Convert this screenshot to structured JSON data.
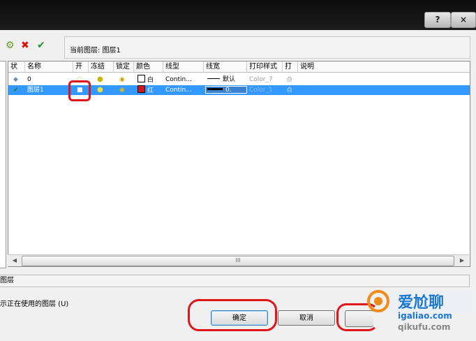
{
  "window": {
    "help_label": "?",
    "close_label": "×"
  },
  "toolbar": {
    "new_icon": "new-layer-icon",
    "delete_icon": "delete-layer-icon",
    "set_current_icon": "set-current-icon",
    "current_layer_label": "当前图层: 图层1"
  },
  "grid": {
    "columns": [
      "状",
      "名称",
      "开",
      "冻结",
      "锁定",
      "颜色",
      "线型",
      "线宽",
      "打印样式",
      "打",
      "说明"
    ],
    "rows": [
      {
        "status_icon": "layer-state-icon",
        "name": "0",
        "color_name": "白",
        "color_hex": "#ffffff",
        "linetype": "Contin...",
        "lineweight": "默认",
        "plot_style": "Color_7",
        "selected": false
      },
      {
        "status_icon": "current-check-icon",
        "name": "图层1",
        "color_name": "红",
        "color_hex": "#d4161e",
        "linetype": "Contin...",
        "lineweight": "0.",
        "plot_style": "Color_1",
        "selected": true
      }
    ],
    "scroll_label": "III"
  },
  "status": {
    "text": "图层",
    "checkbox_label": "示正在使用的图层 (U)"
  },
  "buttons": {
    "ok": "确定",
    "cancel": "取消"
  },
  "watermark": {
    "line1": "爱尬聊",
    "line2": "igaliao.com",
    "line3": "qikufu.com"
  },
  "colors": {
    "selection": "#3399ff",
    "annotation": "#e0141b",
    "red_layer": "#d4161e"
  }
}
